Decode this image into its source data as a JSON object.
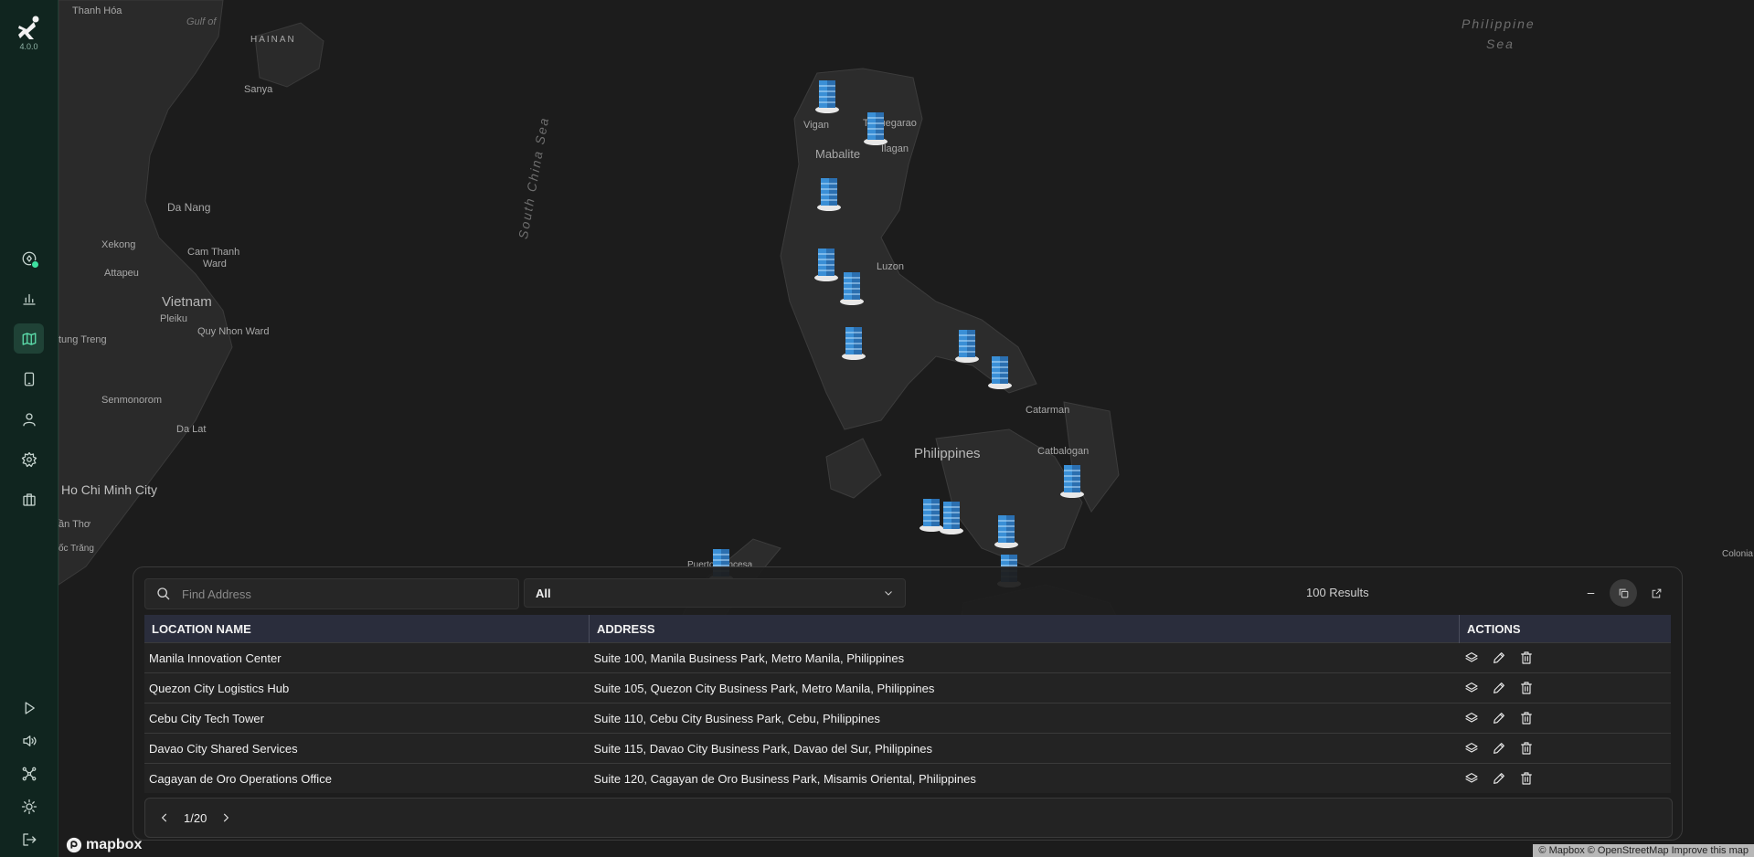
{
  "app": {
    "version": "4.0.0"
  },
  "sidebar": {
    "items": [
      {
        "icon": "analytics-badge-icon"
      },
      {
        "icon": "bar-chart-icon"
      },
      {
        "icon": "map-icon",
        "active": true
      },
      {
        "icon": "tablet-icon"
      },
      {
        "icon": "user-icon"
      },
      {
        "icon": "gear-icon"
      },
      {
        "icon": "briefcase-icon"
      },
      {
        "icon": "play-icon"
      },
      {
        "icon": "speaker-icon"
      },
      {
        "icon": "network-icon"
      },
      {
        "icon": "sun-icon"
      },
      {
        "icon": "logout-icon"
      }
    ]
  },
  "map": {
    "labels": {
      "thanh_hoa": "Thanh Hóa",
      "gulf": "Gulf of",
      "hainan": "HAINAN",
      "sanya": "Sanya",
      "philippine_sea": "Philippine",
      "sea2": "Sea",
      "da_nang": "Da Nang",
      "xekong": "Xekong",
      "cam_thanh": "Cam Thanh",
      "ward": "Ward",
      "attapeu": "Attapeu",
      "vietnam": "Vietnam",
      "pleiku": "Pleiku",
      "quy_nhon": "Quy Nhon Ward",
      "stung_treng": "tung Treng",
      "senmonorom": "Senmonorom",
      "da_lat": "Da Lat",
      "hcmc": "Ho Chi Minh City",
      "can_tho": "ần Thơ",
      "soc_trang": "ốc Trăng",
      "south_china_sea": "South China Sea",
      "vigan": "Vigan",
      "tuguegarao": "Tuguegarao",
      "ilagan": "Ilagan",
      "mabalite": "Mabalite",
      "luzon": "Luzon",
      "philippines": "Philippines",
      "catarman": "Catarman",
      "catbalogan": "Catbalogan",
      "colonia": "Colonia",
      "puerto": "Puerto Princesa"
    }
  },
  "panel": {
    "search": {
      "placeholder": "Find Address"
    },
    "filter": {
      "selected": "All"
    },
    "results": "100 Results",
    "columns": {
      "name": "LOCATION NAME",
      "address": "ADDRESS",
      "actions": "ACTIONS"
    },
    "rows": [
      {
        "name": "Manila Innovation Center",
        "address": "Suite 100, Manila Business Park, Metro Manila, Philippines"
      },
      {
        "name": "Quezon City Logistics Hub",
        "address": "Suite 105, Quezon City Business Park, Metro Manila, Philippines"
      },
      {
        "name": "Cebu City Tech Tower",
        "address": "Suite 110, Cebu City Business Park, Cebu, Philippines"
      },
      {
        "name": "Davao City Shared Services",
        "address": "Suite 115, Davao City Business Park, Davao del Sur, Philippines"
      },
      {
        "name": "Cagayan de Oro Operations Office",
        "address": "Suite 120, Cagayan de Oro Business Park, Misamis Oriental, Philippines"
      }
    ],
    "pagination": {
      "page": "1/20"
    }
  },
  "footer": {
    "mapbox": "mapbox",
    "attribution": "© Mapbox © OpenStreetMap  Improve this map"
  }
}
